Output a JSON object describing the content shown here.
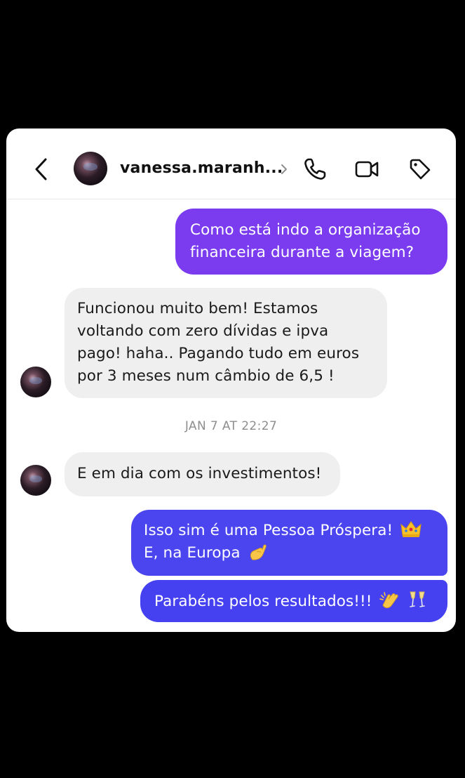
{
  "header": {
    "username": "vanessa.maranh...",
    "chevron": "chevron-right-icon",
    "icons": [
      "back-arrow-icon",
      "phone-icon",
      "video-camera-icon",
      "tag-icon"
    ]
  },
  "messages": {
    "m1": {
      "lines": [
        "Como está indo a organização",
        "financeira durante a viagem?"
      ]
    },
    "m2": {
      "lines": [
        "Funcionou muito bem! Estamos",
        "voltando com zero dívidas e ipva",
        "pago! haha.. Pagando tudo em euros",
        "por 3 meses num câmbio de 6,5 !"
      ]
    },
    "timestamp": "JAN 7 AT 22:27",
    "m3": {
      "lines": [
        "E em dia com os investimentos!"
      ]
    },
    "m4": {
      "lines": [
        "Isso sim é uma Pessoa Próspera!",
        "E, na Europa"
      ],
      "emojis": [
        "crown-emoji",
        "pinching-hand-emoji"
      ]
    },
    "m5": {
      "lines": [
        "Parabéns pelos resultados!!!"
      ],
      "emojis": [
        "clapping-hands-emoji",
        "champagne-glasses-emoji"
      ]
    }
  },
  "colors": {
    "outgoing_1": "#7b3cf0",
    "outgoing_2": "#4a45ef",
    "incoming": "#efefef",
    "timestamp": "#8e8e8e",
    "background": "#000000"
  }
}
